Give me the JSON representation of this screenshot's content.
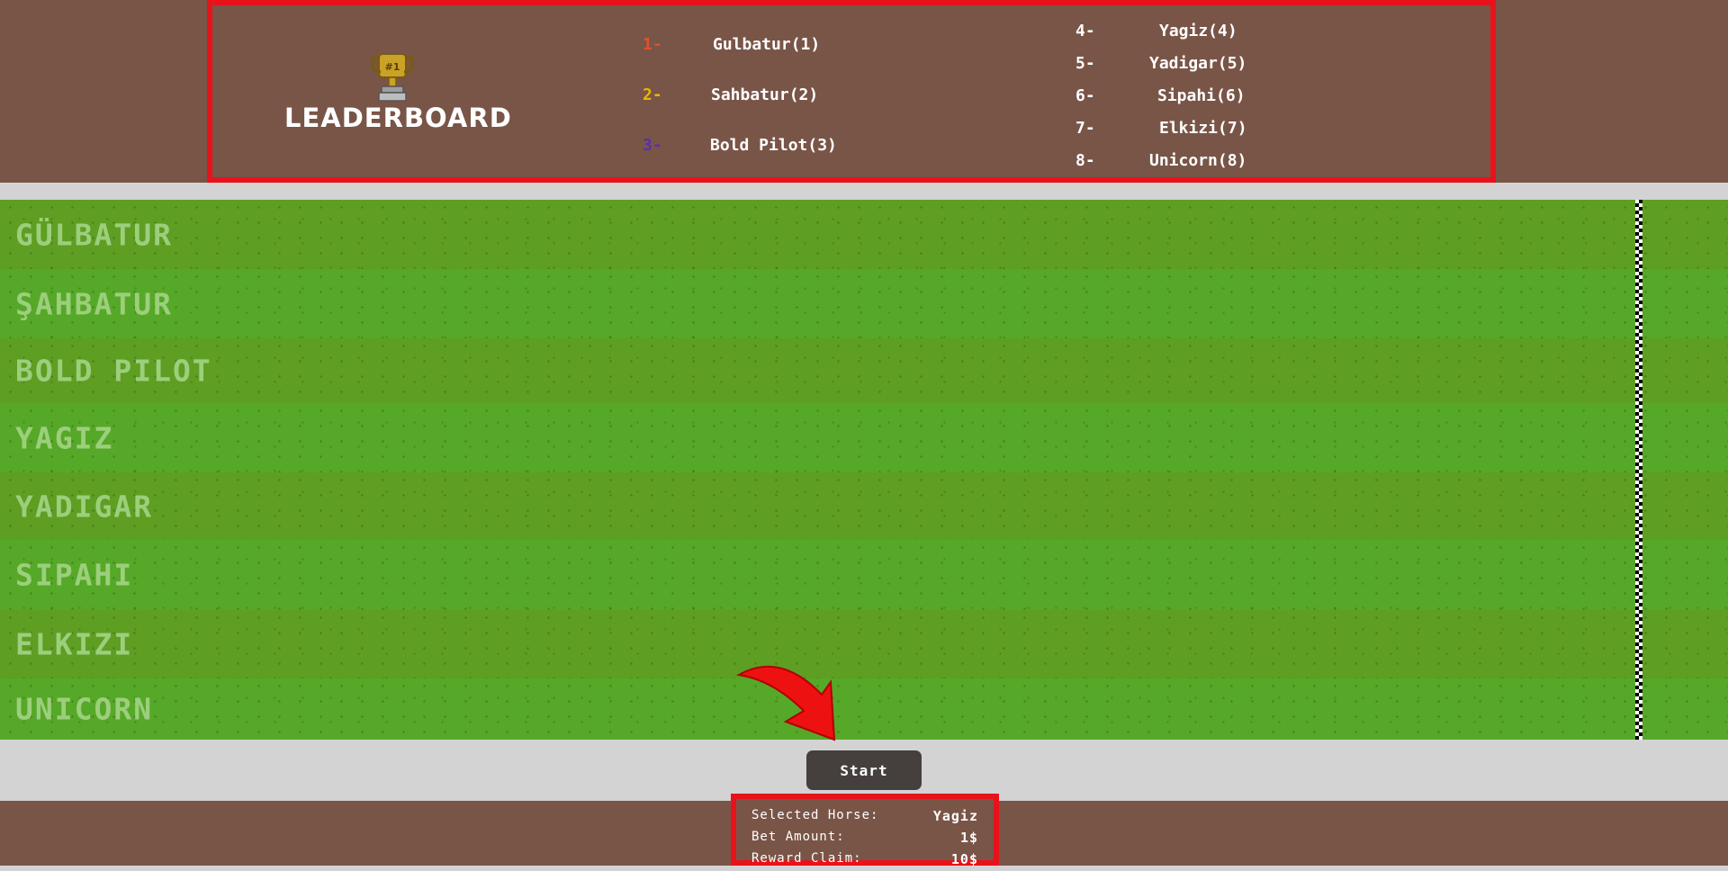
{
  "leaderboard": {
    "title": "LEADERBOARD",
    "trophy_badge": "#1",
    "entries": [
      {
        "rank": "1-",
        "name": "Gulbatur(1)",
        "rank_color": "#e0502a"
      },
      {
        "rank": "2-",
        "name": "Sahbatur(2)",
        "rank_color": "#e6b800"
      },
      {
        "rank": "3-",
        "name": "Bold Pilot(3)",
        "rank_color": "#5a2fb0"
      },
      {
        "rank": "4-",
        "name": "Yagiz(4)",
        "rank_color": "#ffffff"
      },
      {
        "rank": "5-",
        "name": "Yadigar(5)",
        "rank_color": "#ffffff"
      },
      {
        "rank": "6-",
        "name": "Sipahi(6)",
        "rank_color": "#ffffff"
      },
      {
        "rank": "7-",
        "name": "Elkizi(7)",
        "rank_color": "#ffffff"
      },
      {
        "rank": "8-",
        "name": "Unicorn(8)",
        "rank_color": "#ffffff"
      }
    ]
  },
  "lanes": [
    {
      "label": "GÜLBATUR"
    },
    {
      "label": "ŞAHBATUR"
    },
    {
      "label": "BOLD PILOT"
    },
    {
      "label": "YAGIZ"
    },
    {
      "label": "YADIGAR"
    },
    {
      "label": "SIPAHI"
    },
    {
      "label": "ELKIZI"
    },
    {
      "label": "UNICORN"
    }
  ],
  "controls": {
    "start_label": "Start"
  },
  "bet": {
    "selected_horse_label": "Selected Horse:",
    "selected_horse_value": "Yagiz",
    "bet_amount_label": "Bet Amount:",
    "bet_amount_value": "1$",
    "reward_claim_label": "Reward Claim:",
    "reward_claim_value": "10$"
  },
  "colors": {
    "header_brown": "#795548",
    "highlight_red": "#e8121a",
    "grass_dark": "#5e9e23",
    "grass_light": "#56a828",
    "button_dark": "#45403e"
  },
  "icons": {
    "trophy": "trophy-icon",
    "arrow": "red-arrow-icon",
    "finish": "checkered-finish-line"
  }
}
